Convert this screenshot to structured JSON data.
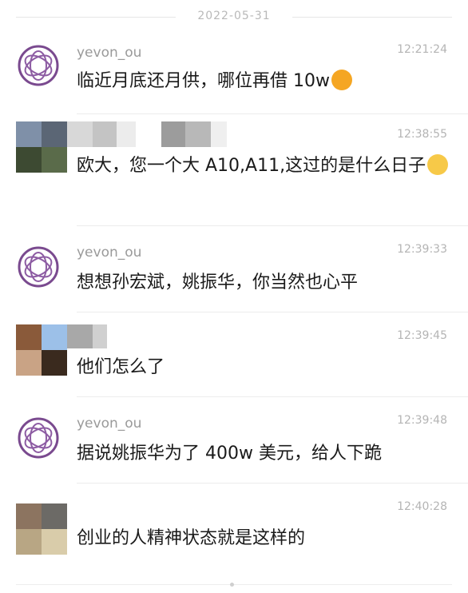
{
  "date_divider": "2022-05-31",
  "messages": [
    {
      "sender": "yevon_ou",
      "time": "12:21:24",
      "text": "临近月底还月供，哪位再借 10w",
      "emoji": "angry-face-emoji"
    },
    {
      "sender": "",
      "time": "12:38:55",
      "text": "欧大，您一个大 A10,A11,这过的是什么日子",
      "emoji": "laughing-tears-emoji"
    },
    {
      "sender": "yevon_ou",
      "time": "12:39:33",
      "text": "想想孙宏斌，姚振华，你当然也心平"
    },
    {
      "sender": "",
      "time": "12:39:45",
      "text": "他们怎么了"
    },
    {
      "sender": "yevon_ou",
      "time": "12:39:48",
      "text": "据说姚振华为了 400w 美元，给人下跪"
    },
    {
      "sender": "",
      "time": "12:40:28",
      "text": "创业的人精神状态就是这样的"
    }
  ],
  "colors": {
    "avatar_ring": "#7a4a8f",
    "text": "#1a1a1a",
    "meta": "#b4b4b4",
    "name": "#9a9a9a"
  }
}
